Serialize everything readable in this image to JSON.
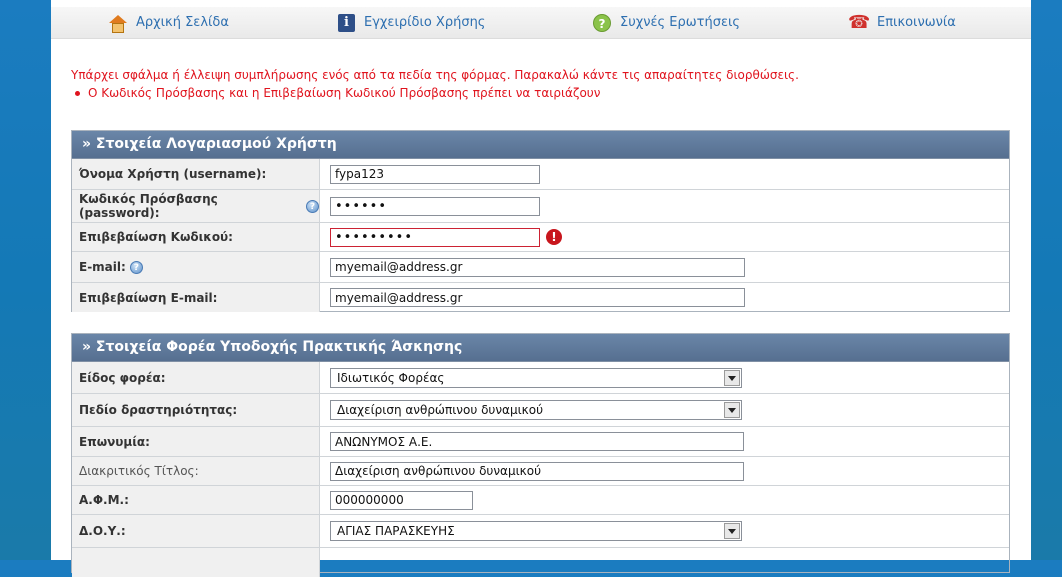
{
  "nav": {
    "home": "Αρχική Σελίδα",
    "manual": "Εγχειρίδιο Χρήσης",
    "faq": "Συχνές Ερωτήσεις",
    "contact": "Επικοινωνία"
  },
  "errors": {
    "message": "Υπάρχει σφάλμα ή έλλειψη συμπλήρωσης ενός από τα πεδία της φόρμας. Παρακαλώ κάντε τις απαραίτητες διορθώσεις.",
    "items": [
      "Ο Κωδικός Πρόσβασης και η Επιβεβαίωση Κωδικού Πρόσβασης πρέπει να ταιριάζουν"
    ]
  },
  "account": {
    "header": "» Στοιχεία Λογαριασμού Χρήστη",
    "username_label": "Όνομα Χρήστη (username):",
    "username_value": "fypa123",
    "password_label": "Κωδικός Πρόσβασης (password):",
    "password_value": "••••••",
    "confirm_label": "Επιβεβαίωση Κωδικού:",
    "confirm_value": "•••••••••",
    "email_label": "E-mail:",
    "email_value": "myemail@address.gr",
    "email_confirm_label": "Επιβεβαίωση E-mail:",
    "email_confirm_value": "myemail@address.gr"
  },
  "provider": {
    "header": "» Στοιχεία Φορέα Υποδοχής Πρακτικής Άσκησης",
    "type_label": "Είδος φορέα:",
    "type_value": "Ιδιωτικός Φορέας",
    "field_label": "Πεδίο δραστηριότητας:",
    "field_value": "Διαχείριση ανθρώπινου δυναμικού",
    "name_label": "Επωνυμία:",
    "name_value": "ΑΝΩΝΥΜΟΣ Α.Ε.",
    "title_label": "Διακριτικός Τίτλος:",
    "title_value": "Διαχείριση ανθρώπινου δυναμικού",
    "afm_label": "Α.Φ.Μ.:",
    "afm_value": "000000000",
    "doy_label": "Δ.Ο.Υ.:",
    "doy_value": "ΑΓΙΑΣ ΠΑΡΑΣΚΕΥΗΣ"
  },
  "icons": {
    "help": "?",
    "error": "!",
    "info": "i",
    "faq": "?",
    "phone": "☎"
  }
}
